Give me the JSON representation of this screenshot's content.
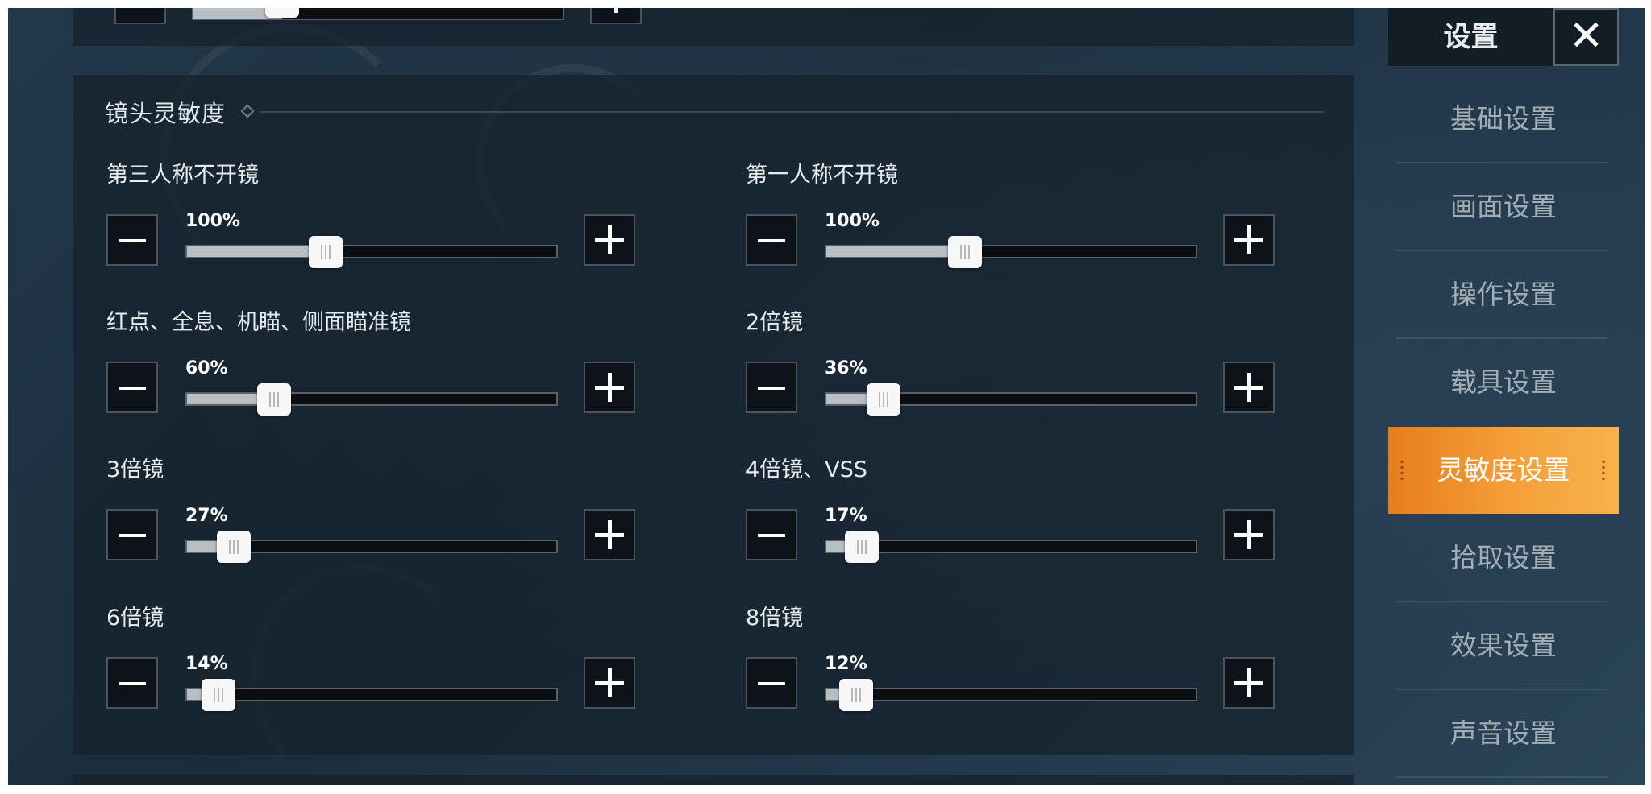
{
  "section": {
    "title": "镜头灵敏度"
  },
  "sliders": [
    {
      "label": "第三人称不开镜",
      "value_text": "100%",
      "level": 0.33
    },
    {
      "label": "第一人称不开镜",
      "value_text": "100%",
      "level": 0.33
    },
    {
      "label": "红点、全息、机瞄、侧面瞄准镜",
      "value_text": "60%",
      "level": 0.19
    },
    {
      "label": "2倍镜",
      "value_text": "36%",
      "level": 0.11
    },
    {
      "label": "3倍镜",
      "value_text": "27%",
      "level": 0.08
    },
    {
      "label": "4倍镜、VSS",
      "value_text": "17%",
      "level": 0.05
    },
    {
      "label": "6倍镜",
      "value_text": "14%",
      "level": 0.04
    },
    {
      "label": "8倍镜",
      "value_text": "12%",
      "level": 0.035
    }
  ],
  "sidebar": {
    "title": "设置",
    "close_symbol": "✕",
    "active_index": 4,
    "items": [
      "基础设置",
      "画面设置",
      "操作设置",
      "载具设置",
      "灵敏度设置",
      "拾取设置",
      "效果设置",
      "声音设置"
    ]
  },
  "colors": {
    "accent": "#f09a33",
    "panel": "#16222d",
    "track_fill": "#b9bec2"
  },
  "icons": {
    "decrease": "minus-icon",
    "increase": "plus-icon",
    "close": "close-icon"
  }
}
